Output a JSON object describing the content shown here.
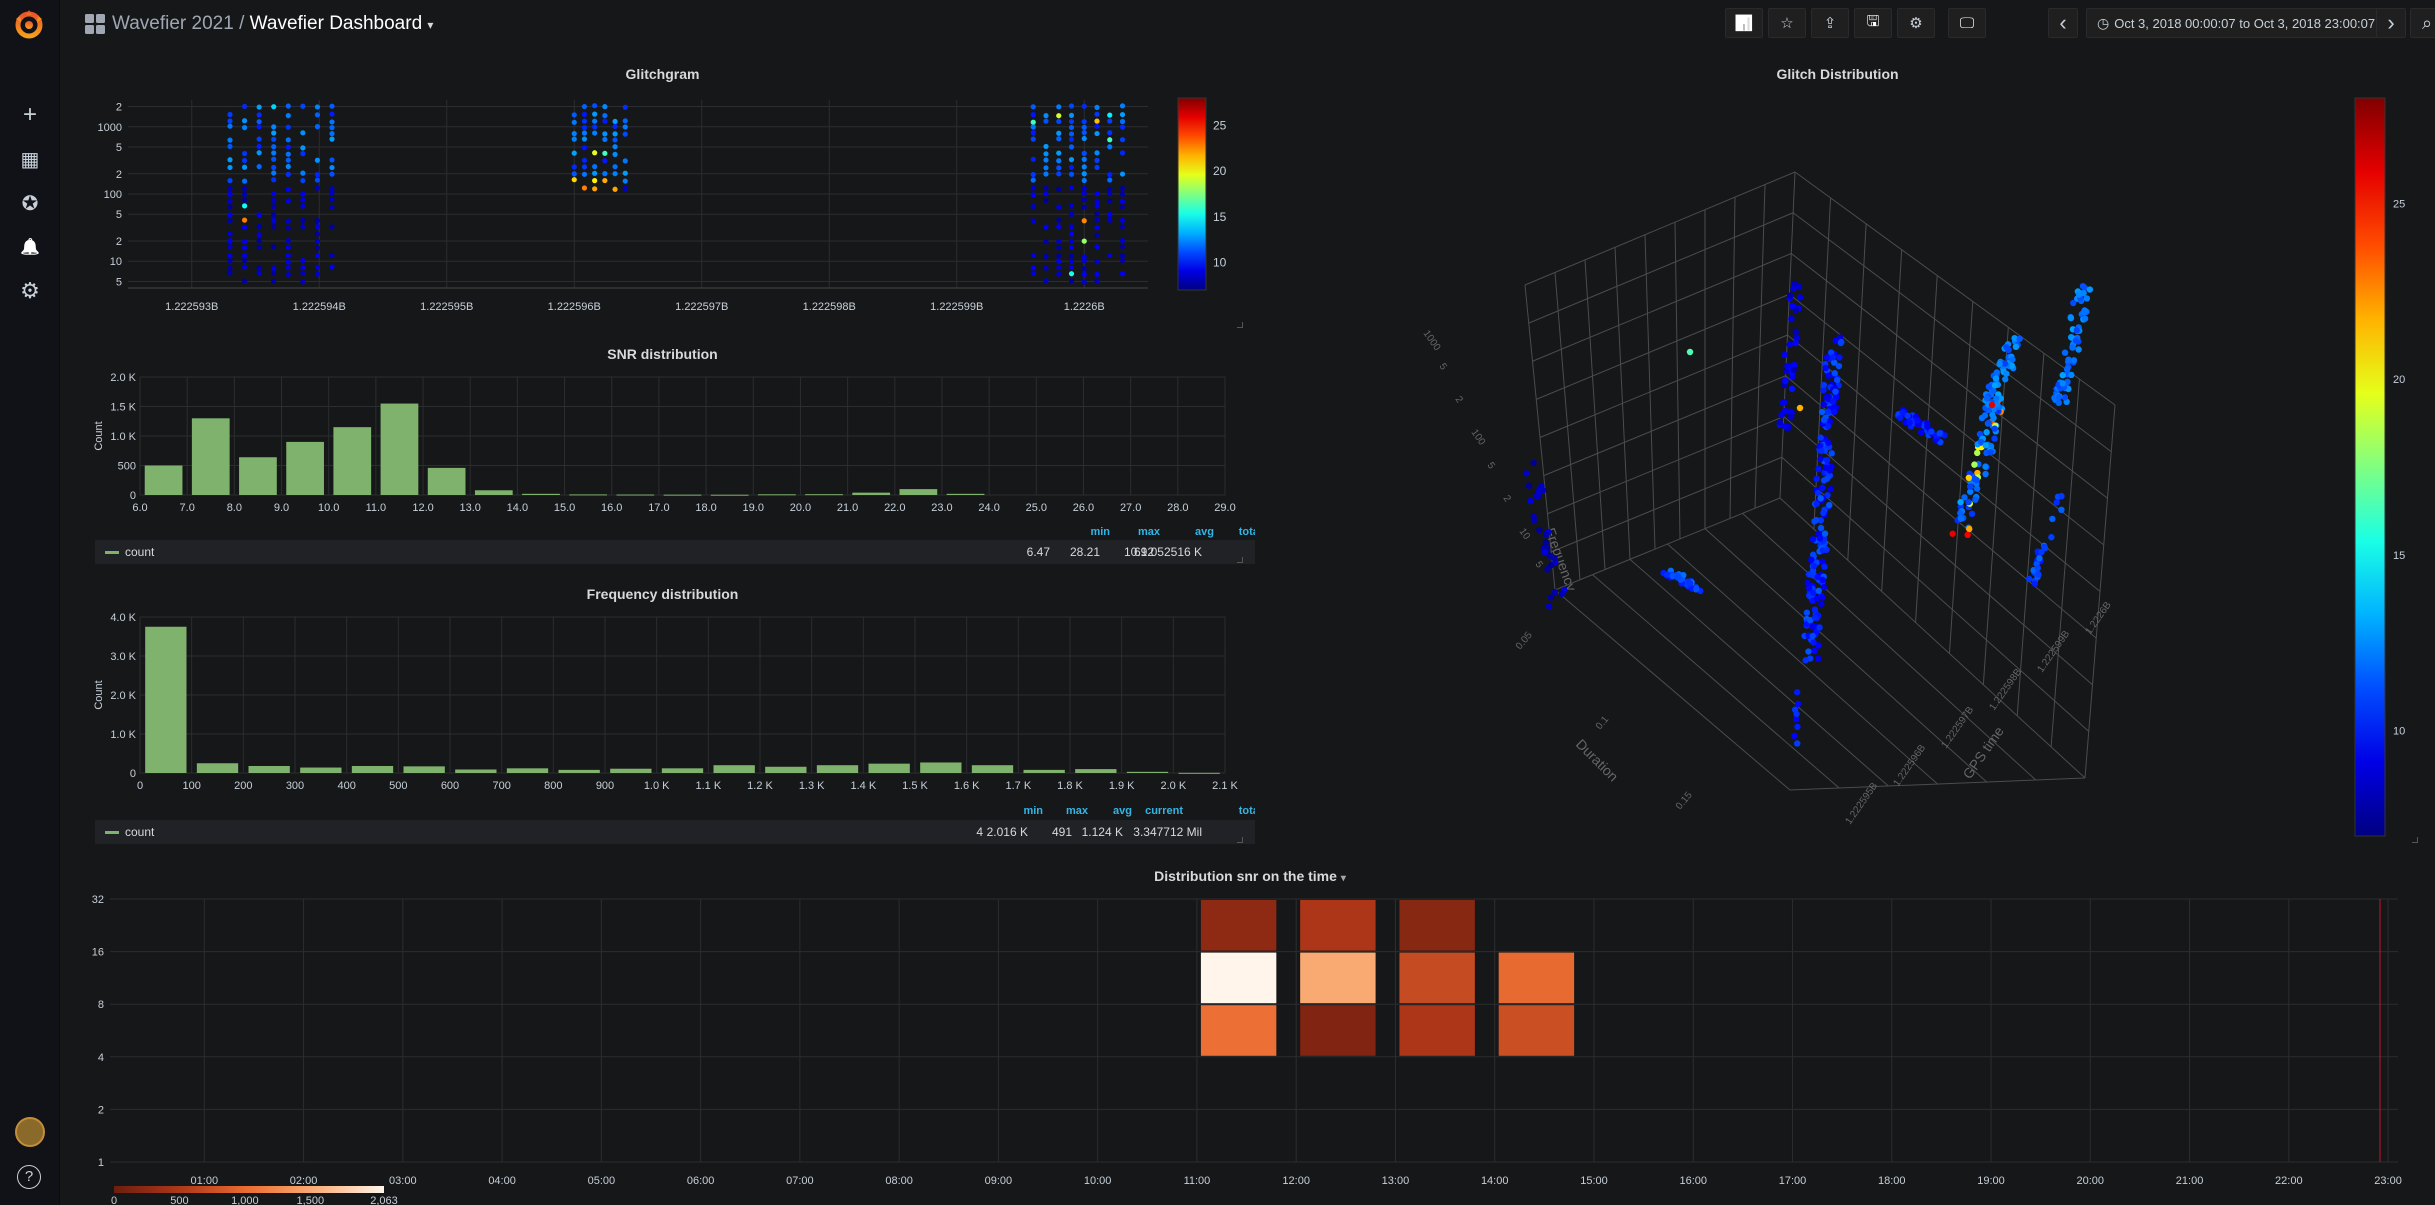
{
  "app": {
    "folder": "Wavefier 2021",
    "separator": "/",
    "dashboard": "Wavefier Dashboard",
    "dashboard_caret": "▾"
  },
  "colors": {
    "accent_orange": "#eb7b18",
    "series_green": "#7eb26d",
    "legend_head": "#33b5e5",
    "heat_low": "#7a2110",
    "heat_high": "#fff5ec"
  },
  "sidemenu": {
    "items": [
      {
        "icon": "plus-icon",
        "glyph": "+"
      },
      {
        "icon": "dashboards-icon",
        "glyph": "▦"
      },
      {
        "icon": "explore-compass-icon",
        "glyph": "✪"
      },
      {
        "icon": "alert-bell-icon",
        "glyph": "🔔"
      },
      {
        "icon": "gear-icon",
        "glyph": "⚙"
      }
    ],
    "help_glyph": "?"
  },
  "toolbar": {
    "add_panel_glyph": "📊",
    "star_glyph": "☆",
    "share_glyph": "⇪",
    "save_glyph": "🖫",
    "settings_glyph": "⚙",
    "tv_glyph": "🖵",
    "prev_glyph": "‹",
    "next_glyph": "›",
    "zoom_glyph": "⌕",
    "refresh_glyph": "⟳",
    "clock_glyph": "◷",
    "time_range": "Oct 3, 2018 00:00:07 to Oct 3, 2018 23:00:07"
  },
  "glitchgram": {
    "title": "Glitchgram",
    "y_ticks": [
      "2",
      "1000",
      "5",
      "2",
      "100",
      "5",
      "2",
      "10",
      "5"
    ],
    "x_ticks": [
      "1.222593B",
      "1.222594B",
      "1.222595B",
      "1.222596B",
      "1.222597B",
      "1.222598B",
      "1.222599B",
      "1.2226B"
    ],
    "colorbar_ticks": [
      "25",
      "20",
      "15",
      "10"
    ]
  },
  "snr": {
    "title": "SNR distribution",
    "ylabel": "Count",
    "legend_series": "count",
    "legend_heads": [
      "min",
      "max",
      "avg",
      "total"
    ],
    "legend_values": [
      "6.47",
      "28.21",
      "10.12",
      "69.052516 K"
    ]
  },
  "freq": {
    "title": "Frequency distribution",
    "ylabel": "Count",
    "legend_series": "count",
    "legend_heads": [
      "min",
      "max",
      "avg",
      "current",
      "total"
    ],
    "legend_values": [
      "4",
      "2.016 K",
      "491",
      "1.124 K",
      "3.347712 Mil"
    ]
  },
  "glitch3d": {
    "title": "Glitch Distribution",
    "axis_frequency": "Frequency",
    "axis_duration": "Duration",
    "axis_gps": "GPS time",
    "freq_ticks": [
      "1000",
      "5",
      "2",
      "100",
      "5",
      "2",
      "10",
      "5"
    ],
    "dur_ticks": [
      "0.05",
      "0.1",
      "0.15"
    ],
    "gps_ticks": [
      "1.2226B",
      "1.222599B",
      "1.222598B",
      "1.222597B",
      "1.222596B",
      "1.222595B"
    ],
    "colorbar_ticks": [
      "25",
      "20",
      "15",
      "10"
    ]
  },
  "heatmap": {
    "title": "Distribution snr on the time",
    "title_caret": "▾",
    "y_ticks": [
      "32",
      "16",
      "8",
      "4",
      "2",
      "1"
    ],
    "x_ticks": [
      "01:00",
      "02:00",
      "03:00",
      "04:00",
      "05:00",
      "06:00",
      "07:00",
      "08:00",
      "09:00",
      "10:00",
      "11:00",
      "12:00",
      "13:00",
      "14:00",
      "15:00",
      "16:00",
      "17:00",
      "18:00",
      "19:00",
      "20:00",
      "21:00",
      "22:00",
      "23:00"
    ],
    "scale_ticks": [
      "0",
      "500",
      "1,000",
      "1,500",
      "2,063"
    ]
  },
  "chart_data": [
    {
      "type": "scatter",
      "title": "Glitchgram",
      "xlabel": "",
      "ylabel": "",
      "x_scale": "gps-time",
      "y_scale": "log",
      "xlim": [
        1222592500,
        1222600500
      ],
      "ylim": [
        4,
        2500
      ],
      "color_scale": "jet",
      "color_range": [
        7,
        28
      ],
      "clusters": [
        {
          "x_range": [
            1222593300,
            1222594100
          ],
          "y_range": [
            4,
            2200
          ],
          "snr": 10
        },
        {
          "x_range": [
            1222596000,
            1222596400
          ],
          "y_range": [
            120,
            2200
          ],
          "snr": 12
        },
        {
          "x_range": [
            1222599600,
            1222600300
          ],
          "y_range": [
            4,
            2200
          ],
          "snr": 10
        }
      ]
    },
    {
      "type": "bar",
      "title": "SNR distribution",
      "xlabel": "",
      "ylabel": "Count",
      "categories": [
        "6.0",
        "7.0",
        "8.0",
        "9.0",
        "10.0",
        "11.0",
        "12.0",
        "13.0",
        "14.0",
        "15.0",
        "16.0",
        "17.0",
        "18.0",
        "19.0",
        "20.0",
        "21.0",
        "22.0",
        "23.0",
        "24.0",
        "25.0",
        "26.0",
        "27.0",
        "28.0"
      ],
      "values": [
        500,
        1300,
        640,
        900,
        1150,
        1550,
        460,
        80,
        20,
        10,
        8,
        6,
        5,
        12,
        14,
        40,
        100,
        20,
        0,
        0,
        0,
        0,
        0
      ],
      "x_ticks": [
        "6.0",
        "7.0",
        "8.0",
        "9.0",
        "10.0",
        "11.0",
        "12.0",
        "13.0",
        "14.0",
        "15.0",
        "16.0",
        "17.0",
        "18.0",
        "19.0",
        "20.0",
        "21.0",
        "22.0",
        "23.0",
        "24.0",
        "25.0",
        "26.0",
        "27.0",
        "28.0",
        "29.0"
      ],
      "y_ticks": [
        "2.0 K",
        "1.5 K",
        "1.0 K",
        "500",
        "0"
      ],
      "ylim": [
        0,
        2000
      ],
      "grid": true,
      "legend": "bottom"
    },
    {
      "type": "bar",
      "title": "Frequency distribution",
      "xlabel": "",
      "ylabel": "Count",
      "categories": [
        "0",
        "100",
        "200",
        "300",
        "400",
        "500",
        "600",
        "700",
        "800",
        "900",
        "1.0 K",
        "1.1 K",
        "1.2 K",
        "1.3 K",
        "1.4 K",
        "1.5 K",
        "1.6 K",
        "1.7 K",
        "1.8 K",
        "1.9 K",
        "2.0 K"
      ],
      "values": [
        3750,
        250,
        180,
        140,
        180,
        170,
        90,
        120,
        80,
        110,
        120,
        200,
        160,
        200,
        240,
        270,
        200,
        80,
        100,
        30,
        5
      ],
      "x_ticks": [
        "0",
        "100",
        "200",
        "300",
        "400",
        "500",
        "600",
        "700",
        "800",
        "900",
        "1.0 K",
        "1.1 K",
        "1.2 K",
        "1.3 K",
        "1.4 K",
        "1.5 K",
        "1.6 K",
        "1.7 K",
        "1.8 K",
        "1.9 K",
        "2.0 K",
        "2.1 K"
      ],
      "y_ticks": [
        "4.0 K",
        "3.0 K",
        "2.0 K",
        "1.0 K",
        "0"
      ],
      "ylim": [
        0,
        4000
      ],
      "grid": true,
      "legend": "bottom"
    },
    {
      "type": "heatmap",
      "title": "Distribution snr on the time",
      "xlabel": "",
      "ylabel": "",
      "y_scale": "log2",
      "cells": [
        {
          "x": "11:00",
          "y": [
            16,
            32
          ],
          "value": 250
        },
        {
          "x": "12:00",
          "y": [
            16,
            32
          ],
          "value": 500
        },
        {
          "x": "13:00",
          "y": [
            16,
            32
          ],
          "value": 200
        },
        {
          "x": "11:00",
          "y": [
            8,
            16
          ],
          "value": 2063
        },
        {
          "x": "12:00",
          "y": [
            8,
            16
          ],
          "value": 1500
        },
        {
          "x": "13:00",
          "y": [
            8,
            16
          ],
          "value": 700
        },
        {
          "x": "14:00",
          "y": [
            8,
            16
          ],
          "value": 1000
        },
        {
          "x": "11:00",
          "y": [
            4,
            8
          ],
          "value": 1050
        },
        {
          "x": "12:00",
          "y": [
            4,
            8
          ],
          "value": 150
        },
        {
          "x": "13:00",
          "y": [
            4,
            8
          ],
          "value": 500
        },
        {
          "x": "14:00",
          "y": [
            4,
            8
          ],
          "value": 750
        }
      ],
      "color_range": [
        0,
        2063
      ]
    }
  ]
}
